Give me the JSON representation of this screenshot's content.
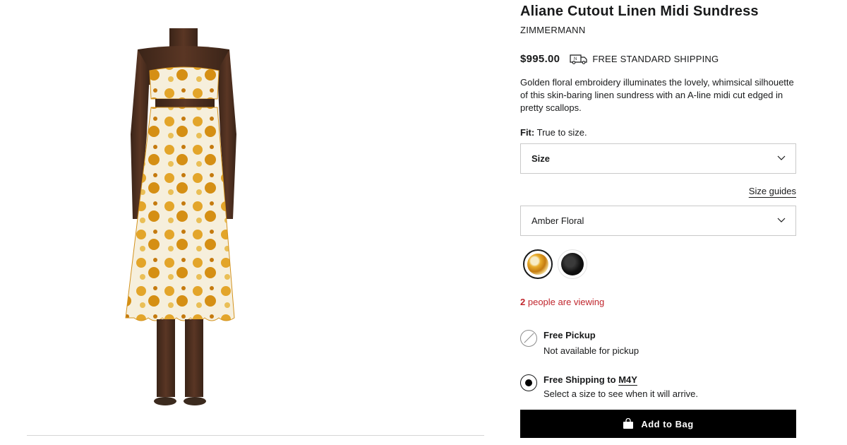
{
  "product": {
    "title": "Aliane Cutout Linen Midi Sundress",
    "brand": "ZIMMERMANN",
    "price": "$995.00",
    "shipping_label": "FREE STANDARD SHIPPING",
    "description": "Golden floral embroidery illuminates the lovely, whimsical silhouette of this skin-baring linen sundress with an A-line midi cut edged in pretty scallops.",
    "fit_key": "Fit:",
    "fit_value": "True to size."
  },
  "size_select": {
    "label": "Size",
    "icon": "chevron-down-icon"
  },
  "size_guides_label": "Size guides",
  "color_select": {
    "value": "Amber Floral",
    "icon": "chevron-down-icon"
  },
  "swatches": [
    {
      "name": "Amber Floral",
      "selected": true,
      "color": "#e0a128"
    },
    {
      "name": "Black",
      "selected": false,
      "color": "#111111"
    }
  ],
  "viewing": {
    "count": "2",
    "text": "people are viewing",
    "color": "#c0262d"
  },
  "fulfillment": {
    "pickup": {
      "title": "Free Pickup",
      "subtitle": "Not available for pickup",
      "available": false
    },
    "shipping": {
      "title_prefix": "Free Shipping to",
      "zip": "M4Y",
      "subtitle": "Select a size to see when it will arrive.",
      "selected": true
    }
  },
  "add_to_bag_label": "Add to Bag",
  "icons": {
    "shipping": "truck-icon",
    "bag": "bag-icon"
  }
}
